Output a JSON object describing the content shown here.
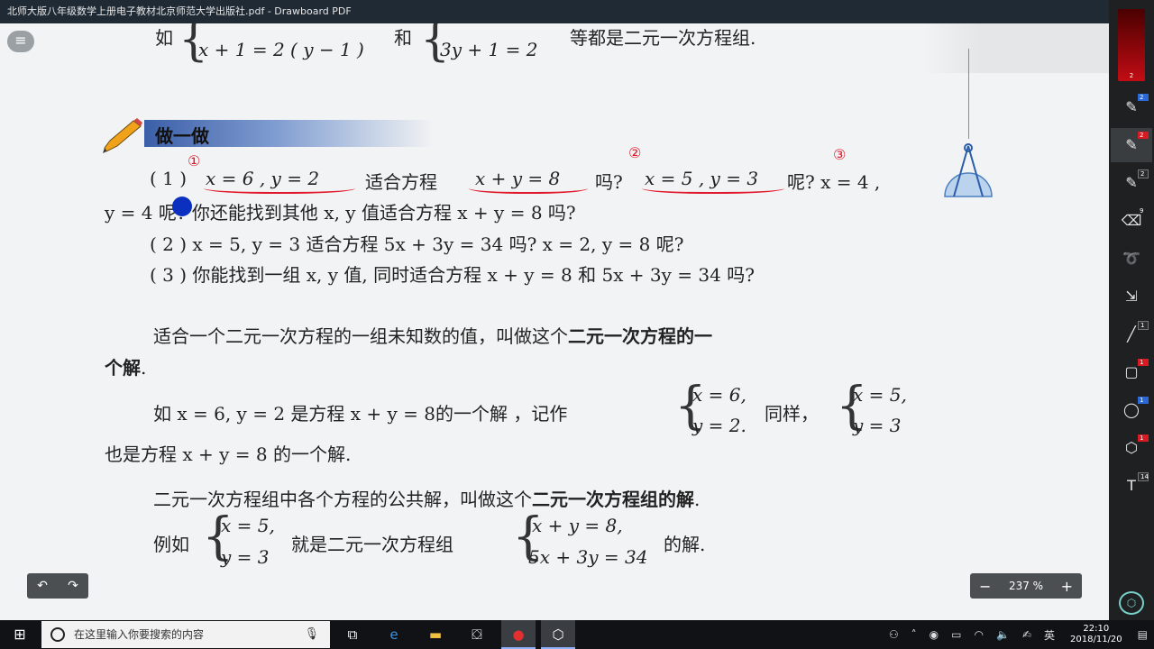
{
  "window": {
    "title": "北师大版八年级数学上册电子教材北京师范大学出版社.pdf - Drawboard PDF",
    "controls": [
      "—",
      "❐",
      "✕"
    ]
  },
  "doc": {
    "top_line": {
      "prefix": "如",
      "sys1_line2": "x + 1 = 2 ( y − 1 )",
      "and": "和",
      "sys2_line2": "3y + 1 = 2",
      "suffix": "等都是二元一次方程组."
    },
    "section_title": "做一做",
    "q1_line1": {
      "label": "( 1 )",
      "eq1": "x = 6 , y = 2",
      "t1": "适合方程",
      "eq2": "x + y = 8",
      "t2": "吗?",
      "eq3": "x = 5 , y = 3",
      "t3": "呢? x = 4 ,"
    },
    "q1_line2": "y = 4 呢?  你还能找到其他 x, y 值适合方程 x + y = 8 吗?",
    "q2": "( 2 ) x = 5, y = 3 适合方程 5x + 3y = 34 吗? x = 2, y = 8 呢?",
    "q3": "( 3 ) 你能找到一组 x, y 值, 同时适合方程 x + y = 8 和 5x + 3y = 34 吗?",
    "def1_a": "适合一个二元一次方程的一组未知数的值，叫做这个",
    "def1_bold": "二元一次方程的一",
    "def1_b_bold": "个解",
    "def1_b_end": ".",
    "ex1": {
      "pre": "如 x = 6, y = 2 是方程 x + y = 8的一个解 ，记作",
      "s1a": "x = 6,",
      "s1b": "y = 2.",
      "mid": "同样，",
      "s2a": "x = 5,",
      "s2b": "y = 3"
    },
    "ex1_line2": "也是方程 x + y = 8 的一个解.",
    "def2_a": "二元一次方程组中各个方程的公共解，叫做这个",
    "def2_bold": "二元一次方程组的解",
    "def2_end": ".",
    "ex2": {
      "pre": "例如",
      "s1a": "x = 5,",
      "s1b": "y = 3",
      "mid": "就是二元一次方程组",
      "s2a": "x + y = 8,",
      "s2b": "5x + 3y = 34",
      "end": "的解."
    }
  },
  "annotations": {
    "mark1": "①",
    "mark2": "②",
    "mark3": "③"
  },
  "controls": {
    "zoom_minus": "−",
    "zoom_value": "237 %",
    "zoom_plus": "+",
    "undo": "↶",
    "redo": "↷"
  },
  "toolbar": {
    "color_badge": "2",
    "tools": [
      {
        "icon": "pen-icon",
        "glyph": "✎",
        "badge": "2",
        "badge_color": "blue"
      },
      {
        "icon": "pen-icon",
        "glyph": "✎",
        "badge": "2",
        "badge_color": "red"
      },
      {
        "icon": "highlighter-icon",
        "glyph": "✎",
        "badge": "2",
        "badge_color": "dark"
      },
      {
        "icon": "eraser-icon",
        "glyph": "⌫",
        "badge": "9",
        "badge_color": "none"
      },
      {
        "icon": "lasso-icon",
        "glyph": "➰",
        "badge": "",
        "badge_color": "none"
      },
      {
        "icon": "select-icon",
        "glyph": "⇲",
        "badge": "",
        "badge_color": "none"
      },
      {
        "icon": "line-icon",
        "glyph": "╱",
        "badge": "1",
        "badge_color": "dark"
      },
      {
        "icon": "rectangle-icon",
        "glyph": "▢",
        "badge": "1",
        "badge_color": "red"
      },
      {
        "icon": "ellipse-icon",
        "glyph": "◯",
        "badge": "1",
        "badge_color": "blue"
      },
      {
        "icon": "polygon-icon",
        "glyph": "⬡",
        "badge": "1",
        "badge_color": "red"
      },
      {
        "icon": "text-icon",
        "glyph": "T",
        "badge": "14",
        "badge_color": "dark"
      }
    ],
    "bottom": "⬡"
  },
  "taskbar": {
    "search_placeholder": "在这里输入你要搜索的内容",
    "time": "22:10",
    "date": "2018/11/20",
    "ime": "英"
  }
}
